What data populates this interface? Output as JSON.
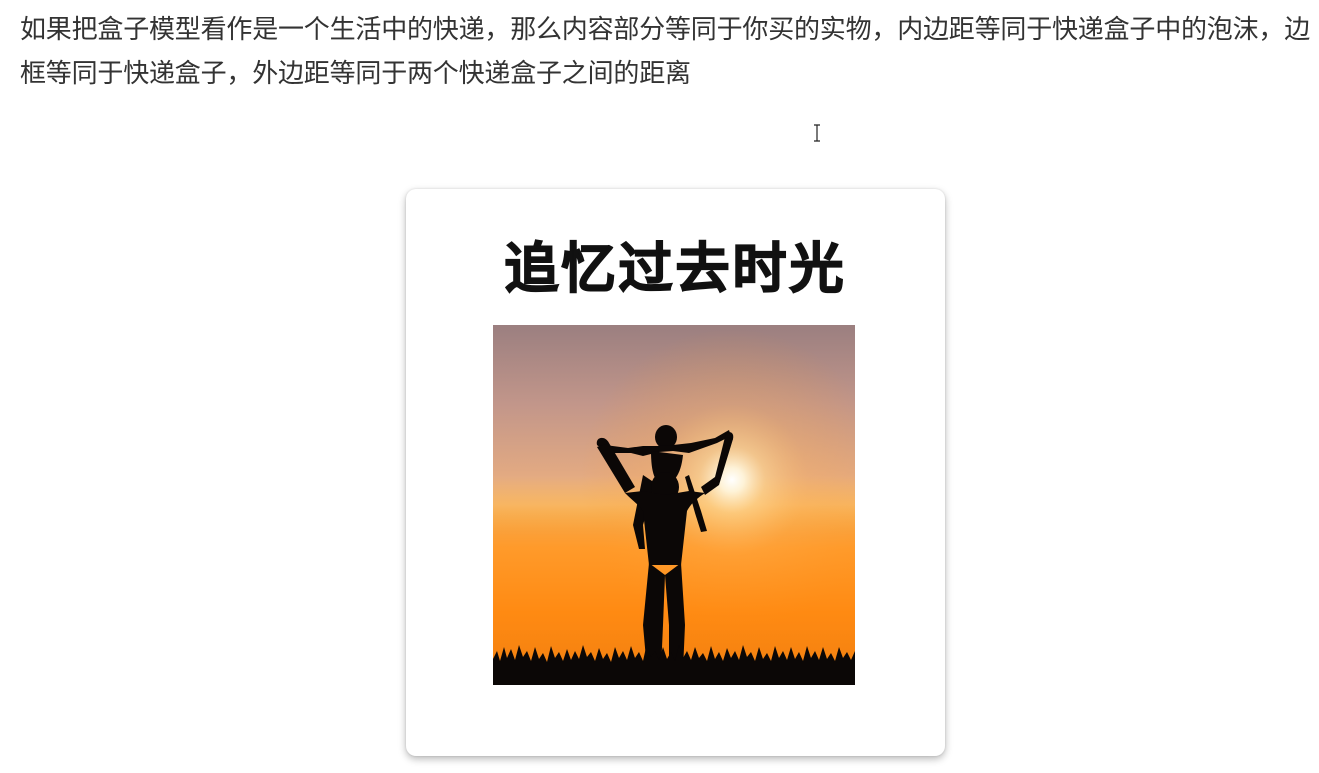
{
  "article": {
    "paragraph": "如果把盒子模型看作是一个生活中的快递，那么内容部分等同于你买的实物，内边距等同于快递盒子中的泡沫，边框等同于快递盒子，外边距等同于两个快递盒子之间的距离"
  },
  "card": {
    "title": "追忆过去时光",
    "image_subject": "silhouette of a father carrying a child on his shoulders at sunset"
  },
  "colors": {
    "text": "#333333",
    "card_background": "#ffffff",
    "title": "#111111",
    "sky_top": "#9e8182",
    "sky_glow": "#ff8c0e"
  },
  "icons": {
    "cursor": "text-cursor-icon"
  }
}
